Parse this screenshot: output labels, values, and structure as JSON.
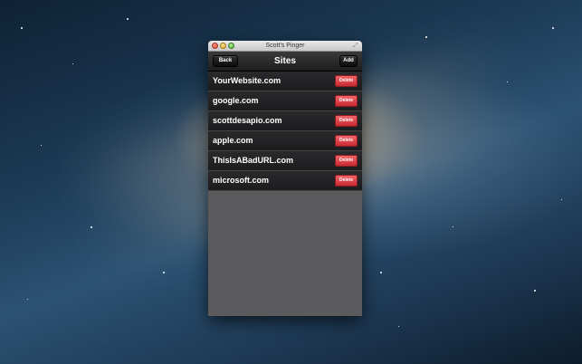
{
  "window": {
    "title": "Scott's Pinger"
  },
  "navbar": {
    "back_label": "Back",
    "title": "Sites",
    "add_label": "Add"
  },
  "sites": [
    {
      "name": "YourWebsite.com",
      "action": "Delete"
    },
    {
      "name": "google.com",
      "action": "Delete"
    },
    {
      "name": "scottdesapio.com",
      "action": "Delete"
    },
    {
      "name": "apple.com",
      "action": "Delete"
    },
    {
      "name": "ThisIsABadURL.com",
      "action": "Delete"
    },
    {
      "name": "microsoft.com",
      "action": "Delete"
    }
  ],
  "colors": {
    "delete_button": "#d83a40",
    "navbar": "#2a2a2a",
    "list_background": "#5b5b5d"
  },
  "icons": [
    "close-window-icon",
    "minimize-window-icon",
    "zoom-window-icon",
    "fullscreen-icon"
  ]
}
